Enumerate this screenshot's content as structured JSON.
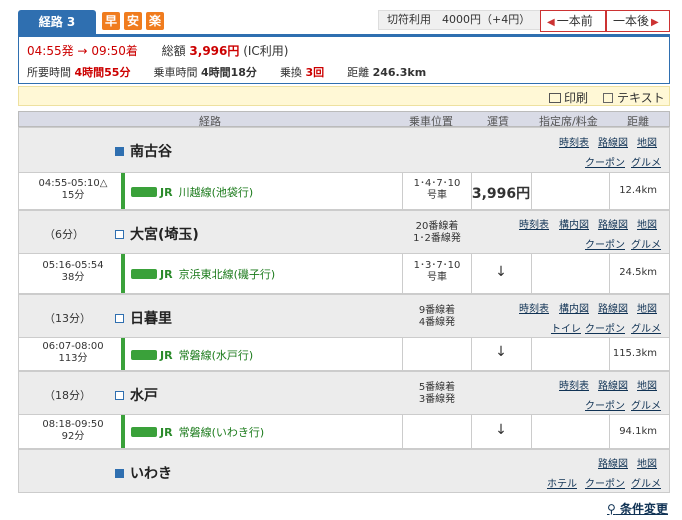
{
  "header": {
    "route_tab": "経路 3",
    "badges": [
      "早",
      "安",
      "楽"
    ],
    "fare_mode": "切符利用　4000円（+4円）",
    "prev_button": "一本前",
    "next_button": "一本後"
  },
  "summary": {
    "depart": "04:55発",
    "arrow": "→",
    "arrive": "09:50着",
    "fare_label": "総額",
    "fare_value": "3,996円",
    "fare_note": "(IC利用)",
    "duration_label": "所要時間",
    "duration_value": "4時間55分",
    "ride_label": "乗車時間",
    "ride_value": "4時間18分",
    "transfer_label": "乗換",
    "transfer_value": "3回",
    "distance_label": "距離",
    "distance_value": "246.3km"
  },
  "toolbar": {
    "print": "印刷",
    "text": "テキスト"
  },
  "table_headers": {
    "route": "経路",
    "position": "乗車位置",
    "fare": "運賃",
    "seat": "指定席/料金",
    "distance": "距離"
  },
  "stops": [
    {
      "name": "南古谷",
      "wait": "",
      "info": [],
      "links1": [
        "時刻表",
        "路線図",
        "地図"
      ],
      "links2": [
        "クーポン",
        "グルメ"
      ]
    },
    {
      "name": "大宮(埼玉)",
      "wait": "（6分）",
      "info": [
        "20番線着",
        "1･2番線発"
      ],
      "links1": [
        "時刻表",
        "構内図",
        "路線図",
        "地図"
      ],
      "links2": [
        "クーポン",
        "グルメ"
      ]
    },
    {
      "name": "日暮里",
      "wait": "（13分）",
      "info": [
        "9番線着",
        "4番線発"
      ],
      "links1": [
        "時刻表",
        "構内図",
        "路線図",
        "地図"
      ],
      "links2": [
        "トイレ",
        "クーポン",
        "グルメ"
      ]
    },
    {
      "name": "水戸",
      "wait": "（18分）",
      "info": [
        "5番線着",
        "3番線発"
      ],
      "links1": [
        "時刻表",
        "路線図",
        "地図"
      ],
      "links2": [
        "クーポン",
        "グルメ"
      ]
    },
    {
      "name": "いわき",
      "wait": "",
      "info": [],
      "links1": [
        "路線図",
        "地図"
      ],
      "links2": [
        "ホテル",
        "クーポン",
        "グルメ"
      ]
    }
  ],
  "segments": [
    {
      "time": "04:55-05:10△",
      "mins": "15分",
      "jr": "JR",
      "line": "川越線(池袋行)",
      "pos1": "1･4･7･10",
      "pos2": "号車",
      "fare": "3,996円",
      "arrow": "",
      "dist": "12.4km"
    },
    {
      "time": "05:16-05:54",
      "mins": "38分",
      "jr": "JR",
      "line": "京浜東北線(磯子行)",
      "pos1": "1･3･7･10",
      "pos2": "号車",
      "fare": "",
      "arrow": "↓",
      "dist": "24.5km"
    },
    {
      "time": "06:07-08:00",
      "mins": "113分",
      "jr": "JR",
      "line": "常磐線(水戸行)",
      "pos1": "",
      "pos2": "",
      "fare": "",
      "arrow": "↓",
      "dist": "115.3km"
    },
    {
      "time": "08:18-09:50",
      "mins": "92分",
      "jr": "JR",
      "line": "常磐線(いわき行)",
      "pos1": "",
      "pos2": "",
      "fare": "",
      "arrow": "↓",
      "dist": "94.1km"
    }
  ],
  "footer": {
    "condition_change": "条件変更"
  },
  "colors": {
    "accent": "#2f6fb0",
    "badge": "#f07c1e",
    "rail_green": "#3aa13a",
    "alert_red": "#cc0000"
  }
}
